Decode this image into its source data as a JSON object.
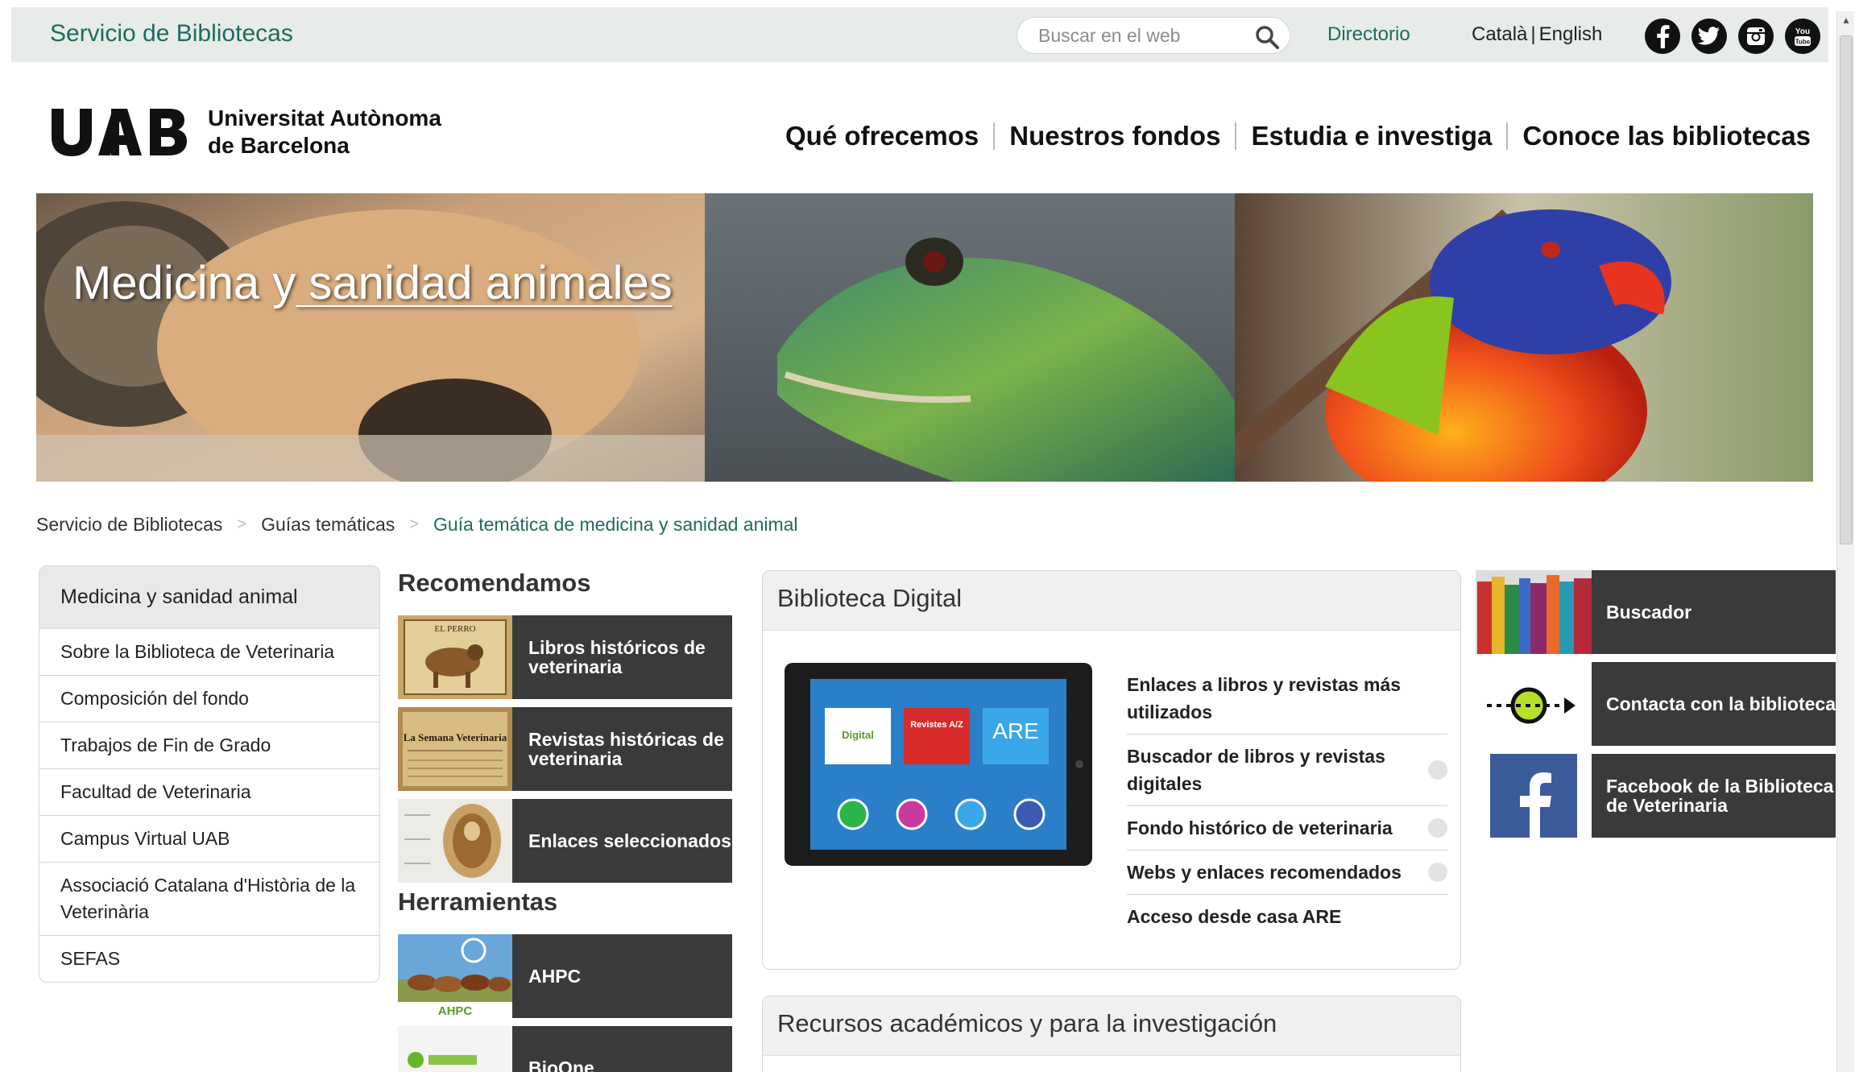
{
  "topbar": {
    "site_name": "Servicio de Bibliotecas",
    "search_placeholder": "Buscar en el web",
    "directory": "Directorio",
    "lang_ca": "Català",
    "lang_sep": "|",
    "lang_en": "English",
    "social": [
      "facebook-icon",
      "twitter-icon",
      "instagram-icon",
      "youtube-icon"
    ],
    "youtube_text": "You Tube"
  },
  "header": {
    "logo_mark": "UAB",
    "logo_line1": "Universitat Autònoma",
    "logo_line2": "de Barcelona",
    "nav": [
      "Qué ofrecemos",
      "Nuestros fondos",
      "Estudia e investiga",
      "Conoce las bibliotecas"
    ]
  },
  "hero": {
    "title_start": "Medicina y",
    "title_end": " sanidad animales"
  },
  "breadcrumb": {
    "items": [
      "Servicio de Bibliotecas",
      "Guías temáticas"
    ],
    "current": "Guía temática de medicina y sanidad animal",
    "separator": ">"
  },
  "leftnav": {
    "title": "Medicina y sanidad animal",
    "items": [
      "Sobre la Biblioteca de Veterinaria",
      "Composición del fondo",
      "Trabajos de Fin de Grado",
      "Facultad de Veterinaria",
      "Campus Virtual UAB",
      "Associació Catalana d'Història de la Veterinària",
      "SEFAS"
    ]
  },
  "recommend": {
    "heading": "Recomendamos",
    "tiles": [
      "Libros históricos de veterinaria",
      "Revistas históricas de veterinaria",
      "Enlaces seleccionados"
    ],
    "thumb_text": [
      "EL PERRO",
      "La Semana Veterinaria"
    ]
  },
  "tools": {
    "heading": "Herramientas",
    "tiles": [
      "AHPC",
      "BioOne"
    ],
    "thumb_text": [
      "AHPC"
    ]
  },
  "digital": {
    "title": "Biblioteca Digital",
    "links": [
      "Enlaces a libros y revistas más utilizados",
      "Buscador de libros y revistas digitales",
      "Fondo histórico de veterinaria",
      "Webs y enlaces recomendados",
      "Acceso desde casa ARE"
    ],
    "tablet_apps": [
      "Digital",
      "Revistes A/Z",
      "ARE"
    ]
  },
  "academic": {
    "title": "Recursos académicos y para la investigación"
  },
  "right_tiles": [
    "Buscador",
    "Contacta con la biblioteca",
    "Facebook de la Biblioteca de Veterinaria"
  ],
  "colors": {
    "accent_green": "#1f6b5f",
    "tile_dark": "#3a3a3a",
    "topbar_bg": "#e7ece8"
  }
}
